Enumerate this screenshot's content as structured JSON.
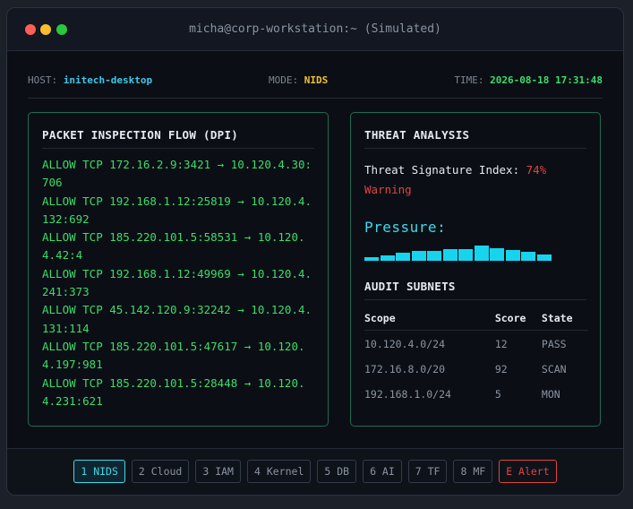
{
  "window": {
    "title": "micha@corp-workstation:~ (Simulated)"
  },
  "status": {
    "host_label": "HOST:",
    "host_value": "initech-desktop",
    "mode_label": "MODE:",
    "mode_value": "NIDS",
    "time_label": "TIME:",
    "time_value": "2026-08-18 17:31:48"
  },
  "packet_panel": {
    "title": "PACKET INSPECTION FLOW (DPI)",
    "packets": [
      "ALLOW TCP 172.16.2.9:3421 → 10.120.4.30:706",
      "ALLOW TCP 192.168.1.12:25819 → 10.120.4.132:692",
      "ALLOW TCP 185.220.101.5:58531 → 10.120.4.42:4",
      "ALLOW TCP 192.168.1.12:49969 → 10.120.4.241:373",
      "ALLOW TCP 45.142.120.9:32242 → 10.120.4.131:114",
      "ALLOW TCP 185.220.101.5:47617 → 10.120.4.197:981",
      "ALLOW TCP 185.220.101.5:28448 → 10.120.4.231:621"
    ]
  },
  "threat_panel": {
    "title": "THREAT ANALYSIS",
    "index_label": "Threat Signature Index:",
    "index_value": "74%",
    "level": "Warning",
    "pressure_label": "Pressure:",
    "pressure_levels": [
      0.2,
      0.3,
      0.45,
      0.55,
      0.55,
      0.65,
      0.65,
      0.85,
      0.7,
      0.6,
      0.5,
      0.35
    ],
    "audit_title": "AUDIT SUBNETS",
    "columns": [
      "Scope",
      "Score",
      "State"
    ],
    "rows": [
      [
        "10.120.4.0/24",
        "12",
        "PASS"
      ],
      [
        "172.16.8.0/20",
        "92",
        "SCAN"
      ],
      [
        "192.168.1.0/24",
        "5",
        "MON"
      ]
    ]
  },
  "tabs": [
    {
      "label": "1 NIDS",
      "state": "active"
    },
    {
      "label": "2 Cloud",
      "state": "normal"
    },
    {
      "label": "3 IAM",
      "state": "normal"
    },
    {
      "label": "4 Kernel",
      "state": "normal"
    },
    {
      "label": "5 DB",
      "state": "normal"
    },
    {
      "label": "6 AI",
      "state": "normal"
    },
    {
      "label": "7 TF",
      "state": "normal"
    },
    {
      "label": "8 MF",
      "state": "normal"
    },
    {
      "label": "E Alert",
      "state": "alert"
    }
  ],
  "colors": {
    "accent": "#3fd9ea",
    "ok": "#3ddc6b",
    "warn": "#e0443f",
    "mode": "#f2c030"
  }
}
